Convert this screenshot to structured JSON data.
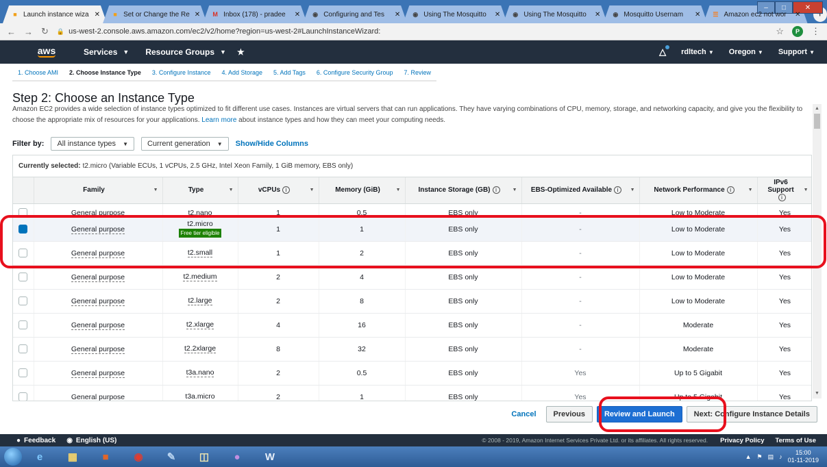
{
  "browser": {
    "tabs": [
      {
        "title": "Launch instance wiza",
        "active": true,
        "icon": "aws-box-icon",
        "icon_color": "#f1a019"
      },
      {
        "title": "Set or Change the Re",
        "active": false,
        "icon": "aws-box-icon",
        "icon_color": "#f1a019"
      },
      {
        "title": "Inbox (178) - pradee",
        "active": false,
        "icon": "gmail-icon",
        "icon_color": "#d93025"
      },
      {
        "title": "Configuring and Tes",
        "active": false,
        "icon": "globe-icon",
        "icon_color": "#444444"
      },
      {
        "title": "Using The Mosquitto",
        "active": false,
        "icon": "globe-icon",
        "icon_color": "#444444"
      },
      {
        "title": "Using The Mosquitto",
        "active": false,
        "icon": "globe-icon",
        "icon_color": "#444444"
      },
      {
        "title": "Mosquitto Usernam",
        "active": false,
        "icon": "globe-icon",
        "icon_color": "#444444"
      },
      {
        "title": "Amazon ec2 not wor",
        "active": false,
        "icon": "stackoverflow-icon",
        "icon_color": "#f48024"
      }
    ],
    "url": "us-west-2.console.aws.amazon.com/ec2/v2/home?region=us-west-2#LaunchInstanceWizard:",
    "profile_initial": "P"
  },
  "aws_header": {
    "logo": "aws",
    "services": "Services",
    "resource_groups": "Resource Groups",
    "account": "rdltech",
    "region": "Oregon",
    "support": "Support"
  },
  "wizard": {
    "steps": [
      {
        "label": "1. Choose AMI",
        "active": false
      },
      {
        "label": "2. Choose Instance Type",
        "active": true
      },
      {
        "label": "3. Configure Instance",
        "active": false
      },
      {
        "label": "4. Add Storage",
        "active": false
      },
      {
        "label": "5. Add Tags",
        "active": false
      },
      {
        "label": "6. Configure Security Group",
        "active": false
      },
      {
        "label": "7. Review",
        "active": false
      }
    ],
    "heading": "Step 2: Choose an Instance Type",
    "desc_before": "Amazon EC2 provides a wide selection of instance types optimized to fit different use cases. Instances are virtual servers that can run applications. They have varying combinations of CPU, memory, storage, and networking capacity, and give you the flexibility to choose the appropriate mix of resources for your applications. ",
    "desc_link": "Learn more",
    "desc_after": " about instance types and how they can meet your computing needs."
  },
  "filters": {
    "label": "Filter by:",
    "instance_types": "All instance types",
    "generation": "Current generation",
    "show_hide": "Show/Hide Columns"
  },
  "current_selection": {
    "label": "Currently selected:",
    "value": "t2.micro (Variable ECUs, 1 vCPUs, 2.5 GHz, Intel Xeon Family, 1 GiB memory, EBS only)"
  },
  "table": {
    "columns": [
      "Family",
      "Type",
      "vCPUs",
      "Memory (GiB)",
      "Instance Storage (GB)",
      "EBS-Optimized Available",
      "Network Performance",
      "IPv6 Support"
    ],
    "rows": [
      {
        "family": "General purpose",
        "type": "t2.nano",
        "vcpus": "1",
        "memory": "0.5",
        "storage": "EBS only",
        "ebs_opt": "-",
        "network": "Low to Moderate",
        "ipv6": "Yes",
        "selected": false,
        "badge": ""
      },
      {
        "family": "General purpose",
        "type": "t2.micro",
        "vcpus": "1",
        "memory": "1",
        "storage": "EBS only",
        "ebs_opt": "-",
        "network": "Low to Moderate",
        "ipv6": "Yes",
        "selected": true,
        "badge": "Free tier eligible"
      },
      {
        "family": "General purpose",
        "type": "t2.small",
        "vcpus": "1",
        "memory": "2",
        "storage": "EBS only",
        "ebs_opt": "-",
        "network": "Low to Moderate",
        "ipv6": "Yes",
        "selected": false,
        "badge": ""
      },
      {
        "family": "General purpose",
        "type": "t2.medium",
        "vcpus": "2",
        "memory": "4",
        "storage": "EBS only",
        "ebs_opt": "-",
        "network": "Low to Moderate",
        "ipv6": "Yes",
        "selected": false,
        "badge": ""
      },
      {
        "family": "General purpose",
        "type": "t2.large",
        "vcpus": "2",
        "memory": "8",
        "storage": "EBS only",
        "ebs_opt": "-",
        "network": "Low to Moderate",
        "ipv6": "Yes",
        "selected": false,
        "badge": ""
      },
      {
        "family": "General purpose",
        "type": "t2.xlarge",
        "vcpus": "4",
        "memory": "16",
        "storage": "EBS only",
        "ebs_opt": "-",
        "network": "Moderate",
        "ipv6": "Yes",
        "selected": false,
        "badge": ""
      },
      {
        "family": "General purpose",
        "type": "t2.2xlarge",
        "vcpus": "8",
        "memory": "32",
        "storage": "EBS only",
        "ebs_opt": "-",
        "network": "Moderate",
        "ipv6": "Yes",
        "selected": false,
        "badge": ""
      },
      {
        "family": "General purpose",
        "type": "t3a.nano",
        "vcpus": "2",
        "memory": "0.5",
        "storage": "EBS only",
        "ebs_opt": "Yes",
        "network": "Up to 5 Gigabit",
        "ipv6": "Yes",
        "selected": false,
        "badge": ""
      },
      {
        "family": "General purpose",
        "type": "t3a.micro",
        "vcpus": "2",
        "memory": "1",
        "storage": "EBS only",
        "ebs_opt": "Yes",
        "network": "Up to 5 Gigabit",
        "ipv6": "Yes",
        "selected": false,
        "badge": ""
      }
    ]
  },
  "actions": {
    "cancel": "Cancel",
    "previous": "Previous",
    "review_launch": "Review and Launch",
    "next": "Next: Configure Instance Details"
  },
  "footer": {
    "feedback": "Feedback",
    "language": "English (US)",
    "copyright": "© 2008 - 2019, Amazon Internet Services Private Ltd. or its affiliates. All rights reserved.",
    "privacy": "Privacy Policy",
    "terms": "Terms of Use"
  },
  "taskbar": {
    "time": "15:00",
    "date": "01-11-2019"
  },
  "colors": {
    "aws_header": "#232f3e",
    "link": "#0073bb",
    "primary_button": "#1d6fd3",
    "free_tier_badge": "#1d8102",
    "annotation_red": "#e8101d"
  }
}
